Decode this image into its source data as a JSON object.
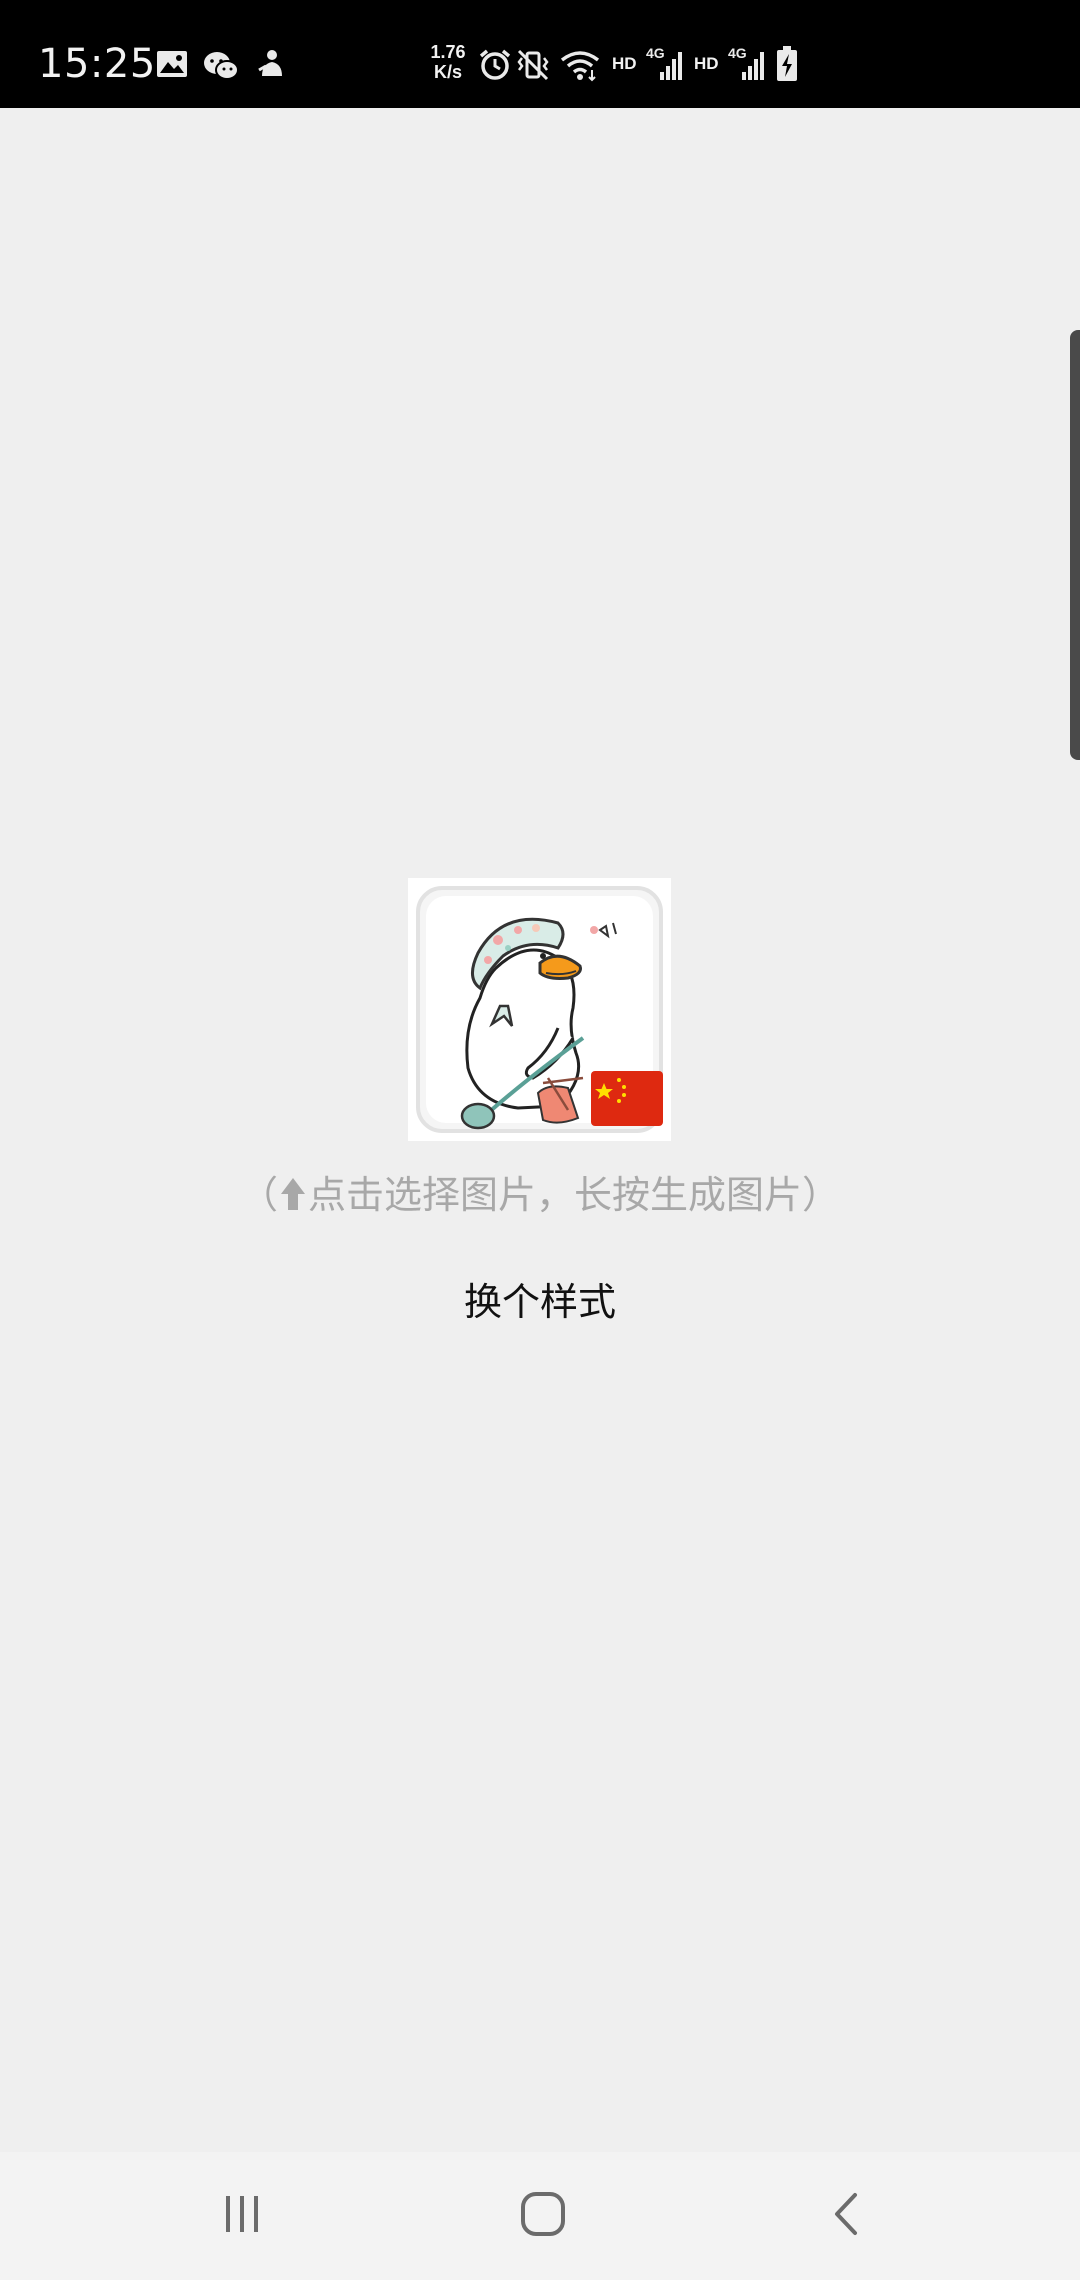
{
  "status_bar": {
    "time": "15:25",
    "net_speed_value": "1.76",
    "net_speed_unit": "K/s",
    "hd_label_1": "HD",
    "hd_label_2": "HD",
    "icons": [
      "gallery-icon",
      "wechat-icon",
      "app-notification-icon",
      "alarm-icon",
      "vibrate-icon",
      "wifi-icon",
      "signal-4g-icon",
      "signal-4g-icon",
      "battery-charging-icon"
    ]
  },
  "main": {
    "image_name": "goose-avatar-with-china-flag",
    "hint_prefix": "（",
    "hint_text": "点击选择图片，长按生成图片）",
    "change_style_label": "换个样式"
  },
  "nav_bar": {
    "icons": [
      "recent-apps-icon",
      "home-icon",
      "back-icon"
    ]
  },
  "colors": {
    "background": "#efefef",
    "status_bar": "#000000",
    "hint_text": "#a8a8a8",
    "flag_red": "#de2910",
    "flag_yellow": "#ffde00"
  }
}
